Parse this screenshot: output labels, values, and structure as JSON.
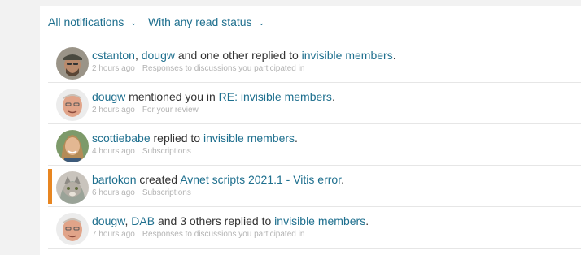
{
  "filters": {
    "type_label": "All notifications",
    "status_label": "With any read status"
  },
  "colors": {
    "link": "#1e6f8e",
    "unread_marker": "#e88621",
    "meta_text": "#b3b3b3"
  },
  "notifications": [
    {
      "actor1": "cstanton",
      "sep1": ", ",
      "actor2": "dougw",
      "action": " and one other replied to ",
      "target": "invisible members",
      "end": ".",
      "time": "2 hours ago",
      "source": "Responses to discussions you participated in",
      "unread": false
    },
    {
      "actor1": "dougw",
      "action": " mentioned you in ",
      "target": "RE: invisible members",
      "end": ".",
      "time": "2 hours ago",
      "source": "For your review",
      "unread": false
    },
    {
      "actor1": "scottiebabe",
      "action": " replied to ",
      "target": "invisible members",
      "end": ".",
      "time": "4 hours ago",
      "source": "Subscriptions",
      "unread": false
    },
    {
      "actor1": "bartokon",
      "action": " created ",
      "target": "Avnet scripts 2021.1 - Vitis error",
      "end": ".",
      "time": "6 hours ago",
      "source": "Subscriptions",
      "unread": true
    },
    {
      "actor1": "dougw",
      "sep1": ", ",
      "actor2": "DAB",
      "action": " and 3 others replied to ",
      "target": "invisible members",
      "end": ".",
      "time": "7 hours ago",
      "source": "Responses to discussions you participated in",
      "unread": false
    }
  ]
}
